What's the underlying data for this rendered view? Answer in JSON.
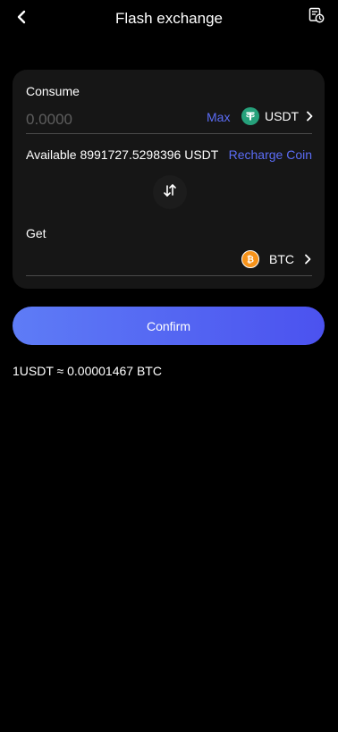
{
  "header": {
    "title": "Flash exchange",
    "back_icon": "chevron-left-icon",
    "history_icon": "record-clock-icon"
  },
  "exchange": {
    "consume_label": "Consume",
    "amount_placeholder": "0.0000",
    "max_label": "Max",
    "from_coin": {
      "name": "USDT",
      "icon": "tether-icon",
      "color": "#26a17b"
    },
    "available_text": "Available 8991727.5298396 USDT",
    "recharge_label": "Recharge Coin",
    "swap_icon": "swap-arrows-icon",
    "get_label": "Get",
    "to_coin": {
      "name": "BTC",
      "icon": "bitcoin-icon",
      "color": "#f7931a"
    }
  },
  "confirm_label": "Confirm",
  "rate_text": "1USDT ≈ 0.00001467 BTC",
  "colors": {
    "background": "#000000",
    "card": "#161616",
    "accent": "#5b6cf5",
    "button_gradient_start": "#5e7cf6",
    "button_gradient_end": "#4b52ef",
    "placeholder": "#5e5e5e"
  }
}
